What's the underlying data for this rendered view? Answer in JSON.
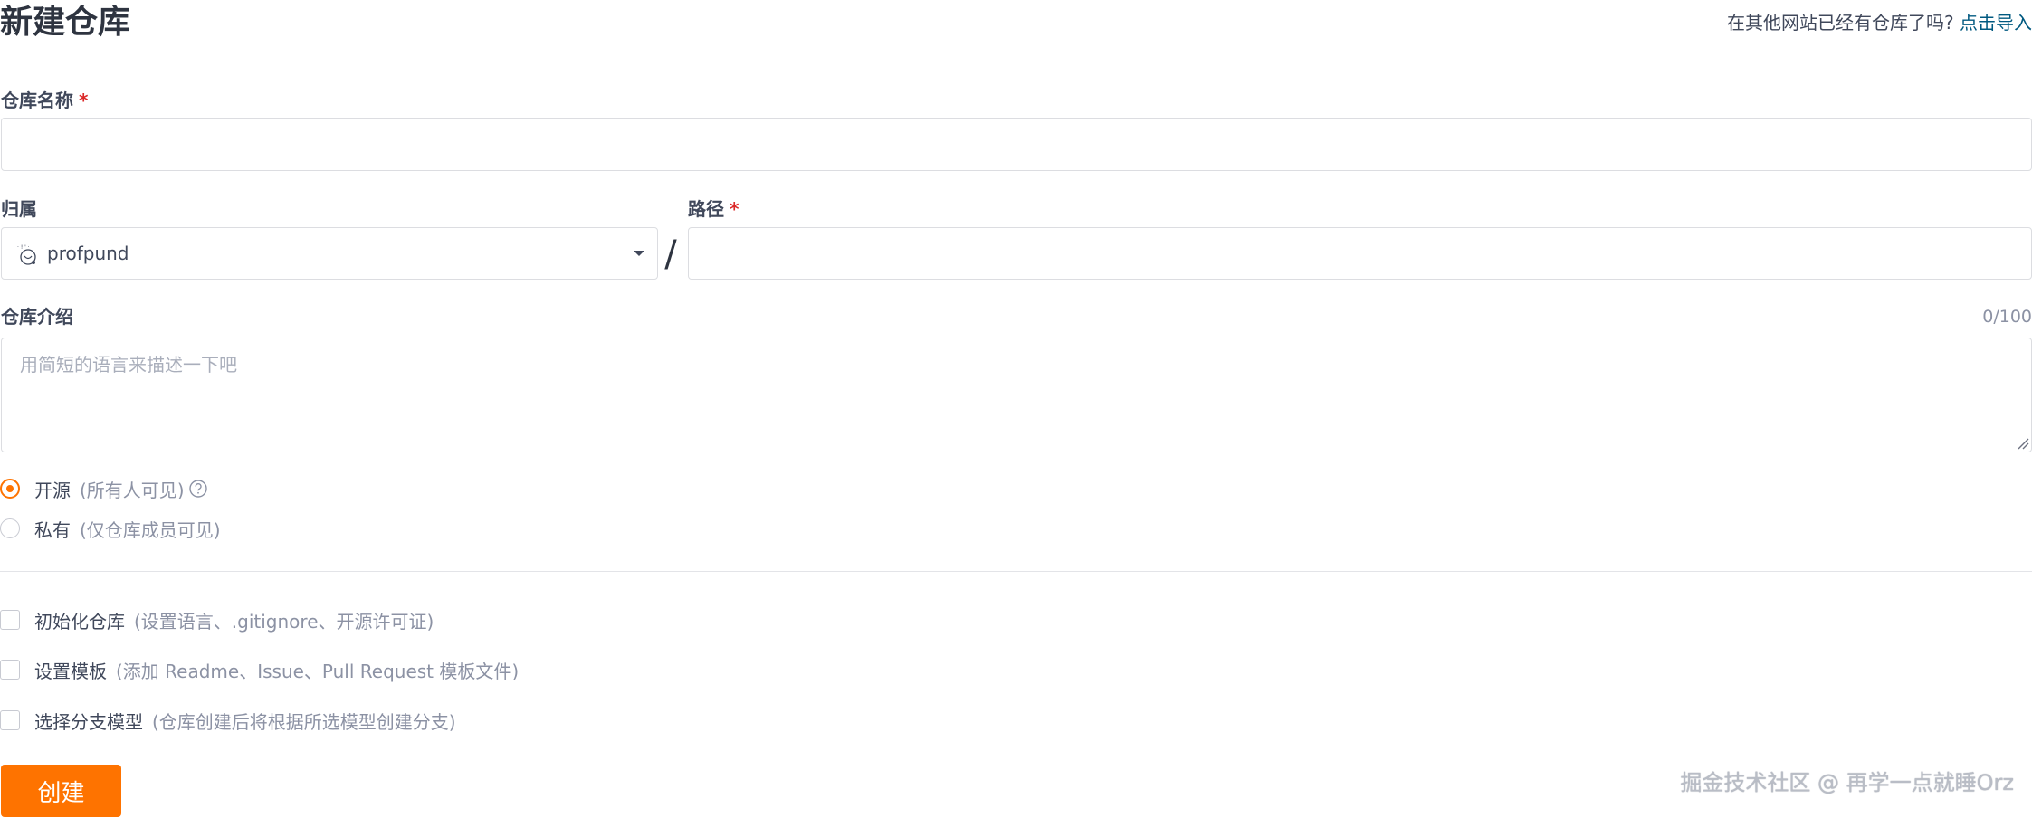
{
  "header": {
    "title": "新建仓库",
    "import_prompt": "在其他网站已经有仓库了吗?",
    "import_link": "点击导入"
  },
  "fields": {
    "repo_name": {
      "label": "仓库名称",
      "required_mark": "*",
      "value": ""
    },
    "owner": {
      "label": "归属",
      "selected": "profpund",
      "avatar_icon": "user-avatar-icon"
    },
    "path_separator": "/",
    "path": {
      "label": "路径",
      "required_mark": "*",
      "value": ""
    },
    "description": {
      "label": "仓库介绍",
      "counter": "0/100",
      "placeholder": "用简短的语言来描述一下吧",
      "value": ""
    }
  },
  "visibility": {
    "options": [
      {
        "label": "开源",
        "note": "(所有人可见)",
        "checked": true,
        "help_icon": "question-circle-icon"
      },
      {
        "label": "私有",
        "note": "(仅仓库成员可见)",
        "checked": false
      }
    ]
  },
  "extras": {
    "options": [
      {
        "label": "初始化仓库",
        "note": "(设置语言、.gitignore、开源许可证)",
        "checked": false
      },
      {
        "label": "设置模板",
        "note": "(添加 Readme、Issue、Pull Request 模板文件)",
        "checked": false
      },
      {
        "label": "选择分支模型",
        "note": "(仓库创建后将根据所选模型创建分支)",
        "checked": false
      }
    ]
  },
  "actions": {
    "create_label": "创建"
  },
  "watermark": "掘金技术社区 @ 再学一点就睡Orz",
  "colors": {
    "accent": "#fe7300",
    "link": "#005980",
    "required": "#db2828",
    "muted_text": "#8c92a4",
    "border": "#dcdde1"
  }
}
